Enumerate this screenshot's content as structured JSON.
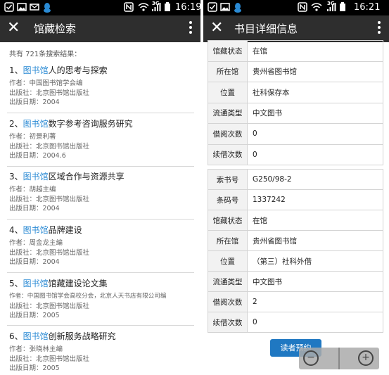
{
  "left": {
    "status": {
      "time": "16:19",
      "icons": [
        "check-icon",
        "image-icon",
        "mail-icon",
        "qq-icon",
        "nfc-icon",
        "wifi-icon",
        "3g-icon",
        "signal-icon",
        "battery-icon"
      ]
    },
    "appbar": {
      "close_glyph": "✕",
      "title": "馆藏检索"
    },
    "count_text": "共有 721条搜索结果：",
    "results": [
      {
        "number": "1、",
        "highlight": "图书馆",
        "rest": "人的思考与探索",
        "author": "作者：中国图书馆学会编",
        "publisher": "出版社：北京图书馆出版社",
        "date": "出版日期：2004"
      },
      {
        "number": "2、",
        "highlight": "图书馆",
        "rest": "数字参考咨询服务研究",
        "author": "作者：初景利著",
        "publisher": "出版社：北京图书馆出版社",
        "date": "出版日期：2004.6"
      },
      {
        "number": "3、",
        "highlight": "图书馆",
        "rest": "区域合作与资源共享",
        "author": "作者：胡越主编",
        "publisher": "出版社：北京图书馆出版社",
        "date": "出版日期：2004"
      },
      {
        "number": "4、",
        "highlight": "图书馆",
        "rest": "品牌建设",
        "author": "作者：周金龙主编",
        "publisher": "出版社：北京图书馆出版社",
        "date": "出版日期：2004"
      },
      {
        "number": "5、",
        "highlight": "图书馆",
        "rest": "馆藏建设论文集",
        "author": "作者：中国图书馆学会高校分会，北京人天书店有限公司编",
        "publisher": "出版社：北京图书馆出版社",
        "date": "出版日期：2005"
      },
      {
        "number": "6、",
        "highlight": "图书馆",
        "rest": "创新服务战略研究",
        "author": "作者：张晓林主编",
        "publisher": "出版社：北京图书馆出版社",
        "date": "出版日期：2005"
      }
    ]
  },
  "right": {
    "status": {
      "time": "16:21",
      "icons": [
        "check-icon",
        "image-icon",
        "qq-icon",
        "nfc-icon",
        "wifi-icon",
        "3g-icon",
        "signal-icon",
        "battery-icon"
      ]
    },
    "appbar": {
      "close_glyph": "✕",
      "title": "书目详细信息"
    },
    "copy1": {
      "status_label": "馆藏状态",
      "status_value": "在馆",
      "location_label": "所在馆",
      "location_value": "贵州省图书馆",
      "position_label": "位置",
      "position_value": "社科保存本",
      "circulation_label": "流通类型",
      "circulation_value": "中文图书",
      "borrow_label": "借阅次数",
      "borrow_value": "0",
      "renew_label": "续借次数",
      "renew_value": "0"
    },
    "copy2": {
      "callno_label": "索书号",
      "callno_value": "G250/98-2",
      "barcode_label": "条码号",
      "barcode_value": "1337242",
      "status_label": "馆藏状态",
      "status_value": "在馆",
      "location_label": "所在馆",
      "location_value": "贵州省图书馆",
      "position_label": "位置",
      "position_value": "（第三）社科外借",
      "circulation_label": "流通类型",
      "circulation_value": "中文图书",
      "borrow_label": "借阅次数",
      "borrow_value": "2",
      "renew_label": "续借次数",
      "renew_value": "0"
    },
    "reserve_label": "读者预约",
    "zoom": {
      "out_glyph": "−",
      "in_glyph": "+"
    }
  },
  "colors": {
    "appbar": "#2e2e2e",
    "statusbar": "#000000",
    "highlight": "#2a8ad4",
    "reserve_button": "#1f78c2"
  }
}
